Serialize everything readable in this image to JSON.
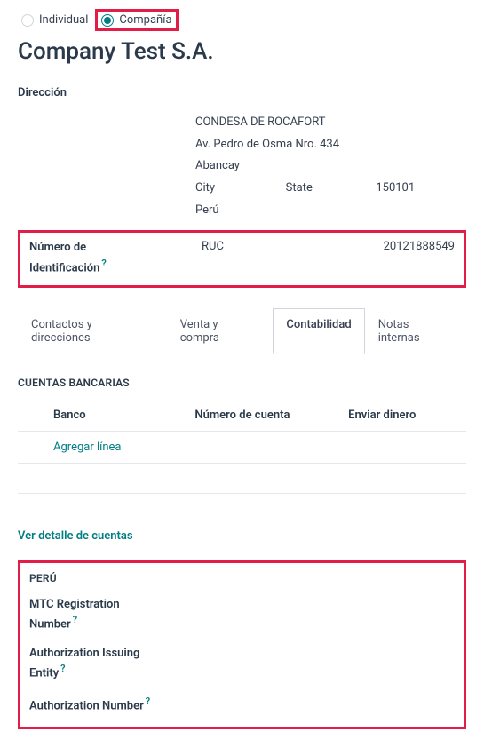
{
  "contact_type": {
    "individual_label": "Individual",
    "company_label": "Compañía",
    "selected": "company"
  },
  "title": "Company Test S.A.",
  "address": {
    "section_label": "Dirección",
    "line1": "CONDESA DE ROCAFORT",
    "line2": "Av. Pedro de Osma Nro. 434",
    "line3": "Abancay",
    "city": "City",
    "state": "State",
    "zip": "150101",
    "country": "Perú"
  },
  "identification": {
    "label_line1": "Número de",
    "label_line2": "Identificación",
    "type": "RUC",
    "number": "20121888549",
    "help": "?"
  },
  "tabs": [
    {
      "label": "Contactos y direcciones",
      "active": false
    },
    {
      "label": "Venta y compra",
      "active": false
    },
    {
      "label": "Contabilidad",
      "active": true
    },
    {
      "label": "Notas internas",
      "active": false
    }
  ],
  "bank_accounts": {
    "title": "CUENTAS BANCARIAS",
    "col_bank": "Banco",
    "col_account": "Número de cuenta",
    "col_send": "Enviar dinero",
    "add_line": "Agregar línea",
    "view_detail": "Ver detalle de cuentas"
  },
  "peru": {
    "title": "PERÚ",
    "fields": [
      {
        "label_line1": "MTC Registration",
        "label_line2": "Number"
      },
      {
        "label_line1": "Authorization Issuing",
        "label_line2": "Entity"
      },
      {
        "label_line1": "Authorization Number",
        "label_line2": ""
      }
    ],
    "help": "?"
  },
  "colors": {
    "teal": "#017e84",
    "highlight": "#e11d48"
  }
}
